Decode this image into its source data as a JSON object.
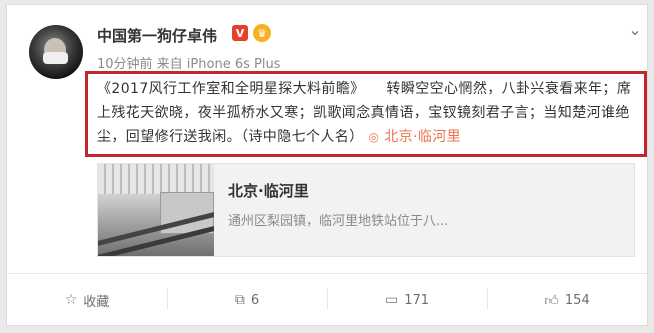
{
  "post": {
    "author": "中国第一狗仔卓伟",
    "verified_badge": "V",
    "crown_badge": "♛",
    "meta": "10分钟前 来自 iPhone 6s Plus",
    "content": "《2017风行工作室和全明星探大料前瞻》　　转瞬空空心惘然，八卦兴衰看来年；席上残花天欲晓，夜半孤桥水又寒；凯歌闻念真情语，宝钗镜刻君子言；当知楚河谁绝尘，回望修行送我闲。（诗中隐七个人名）",
    "location_pin": "◎",
    "location": "北京·临河里"
  },
  "link_card": {
    "title": "北京·临河里",
    "description": "通州区梨园镇，临河里地铁站位于八..."
  },
  "footer": {
    "favorite_label": "收藏",
    "repost_count": "6",
    "comment_count": "171",
    "like_count": "154"
  },
  "colors": {
    "highlight_border": "#c2262c",
    "location_link": "#eb7350",
    "verified_badge": "#e7402a"
  }
}
